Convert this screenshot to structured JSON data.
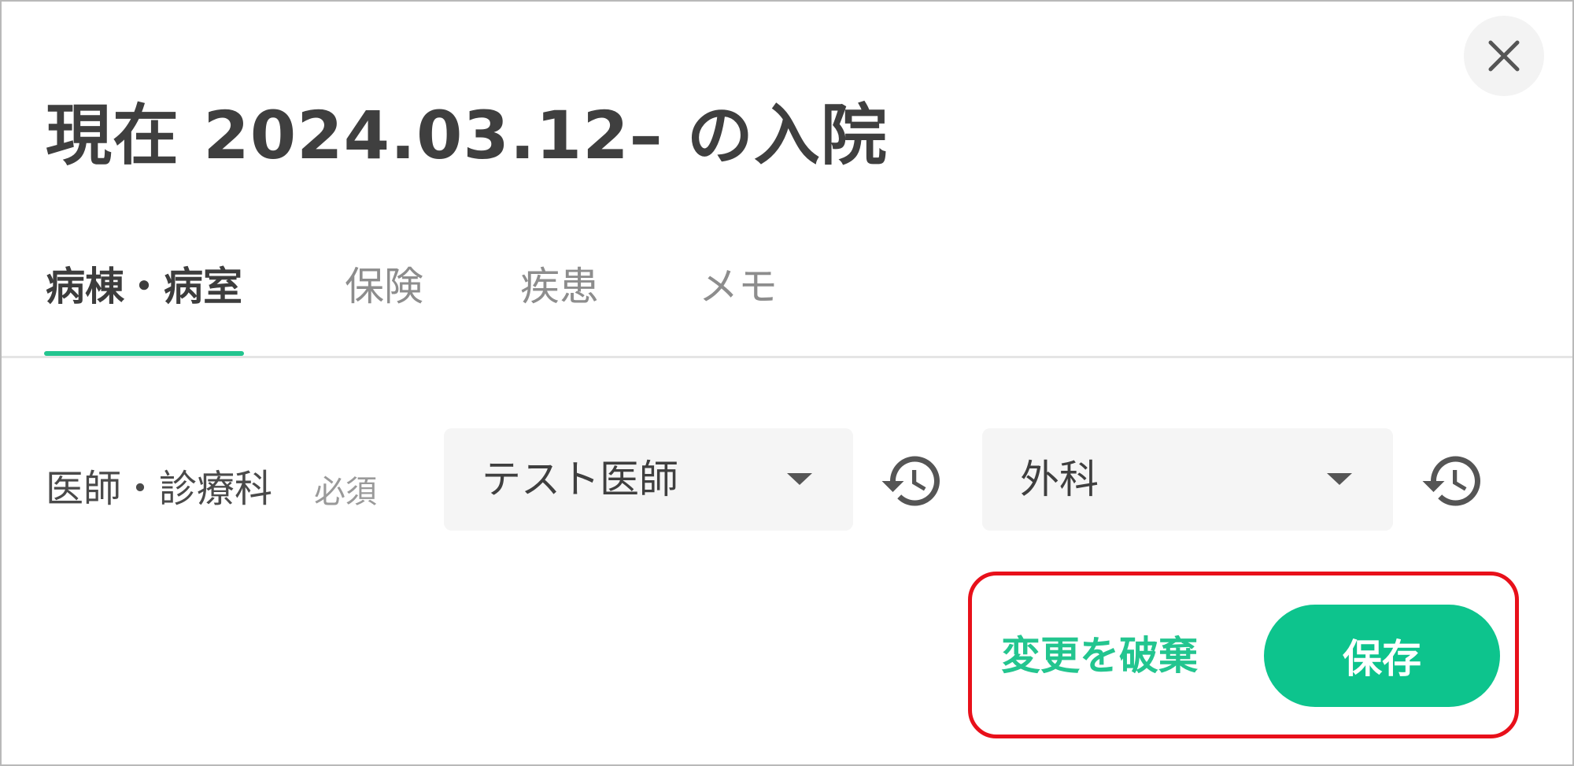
{
  "dialog": {
    "title": "現在 2024.03.12– の入院",
    "close_icon": "close-icon"
  },
  "tabs": [
    {
      "label": "病棟・病室",
      "active": true
    },
    {
      "label": "保険",
      "active": false
    },
    {
      "label": "疾患",
      "active": false
    },
    {
      "label": "メモ",
      "active": false
    }
  ],
  "form": {
    "doctor_department": {
      "label": "医師・診療科",
      "required_label": "必須",
      "doctor_value": "テスト医師",
      "department_value": "外科",
      "dropdown_icon": "caret-down-icon",
      "history_icon": "history-icon"
    }
  },
  "actions": {
    "discard_label": "変更を破棄",
    "save_label": "保存"
  },
  "colors": {
    "accent": "#23C58F",
    "save_button": "#0DC48D",
    "highlight_border": "#E8101A",
    "title_text": "#3F3F3F",
    "muted_text": "#8D8D8D",
    "field_background": "#F5F5F5"
  }
}
